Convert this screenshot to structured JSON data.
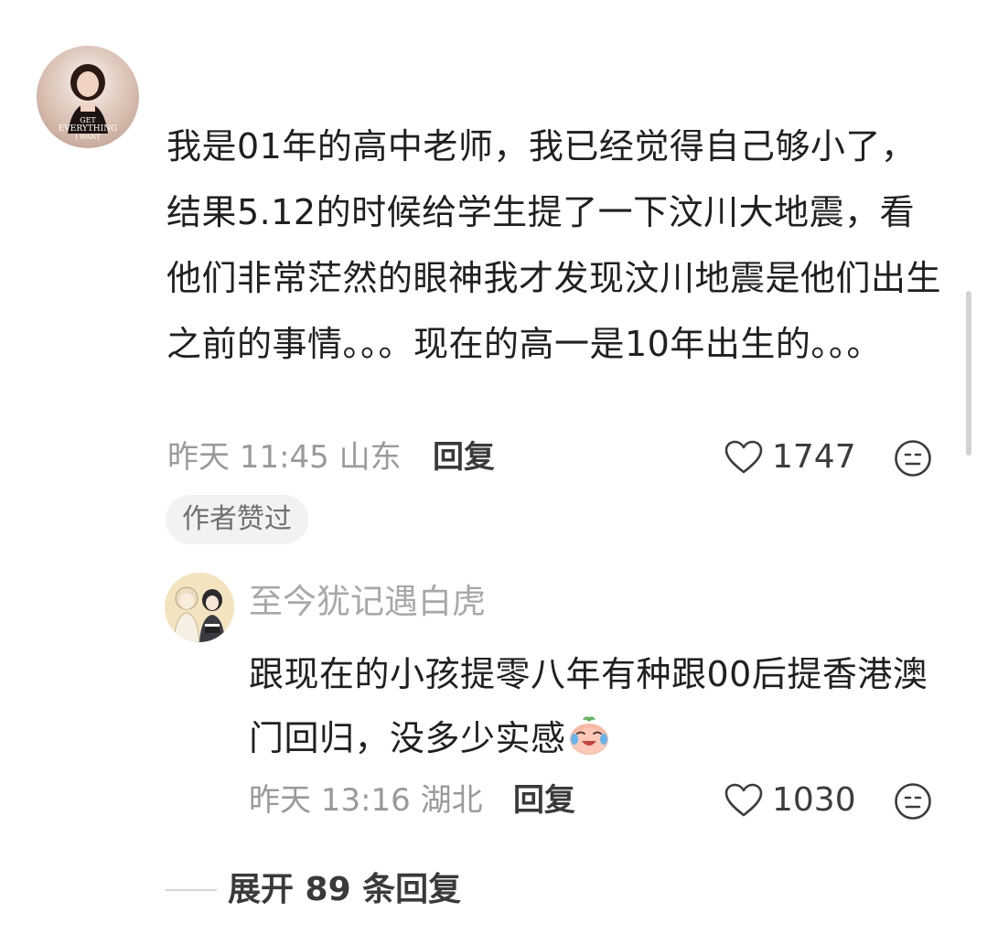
{
  "main_comment": {
    "avatar_text": [
      "GET",
      "EVERYTHING",
      "I WANT"
    ],
    "text": "我是01年的高中老师，我已经觉得自己够小了，结果5.12的时候给学生提了一下汶川大地震，看他们非常茫然的眼神我才发现汶川地震是他们出生之前的事情。。。现在的高一是10年出生的。。。",
    "time_location": "昨天 11:45 山东",
    "reply_label": "回复",
    "like_count": "1747",
    "author_liked": "作者赞过"
  },
  "reply_comment": {
    "username": "至今犹记遇白虎",
    "text": "跟现在的小孩提零八年有种跟00后提香港澳门回归，没多少实感",
    "emoji": "crying-laughing-peach-emoji",
    "time_location": "昨天 13:16 湖北",
    "reply_label": "回复",
    "like_count": "1030"
  },
  "expand_replies": "展开 89 条回复",
  "colors": {
    "text_primary": "#202020",
    "text_secondary": "#9a9a9a",
    "badge_bg": "#f2f2f2"
  }
}
